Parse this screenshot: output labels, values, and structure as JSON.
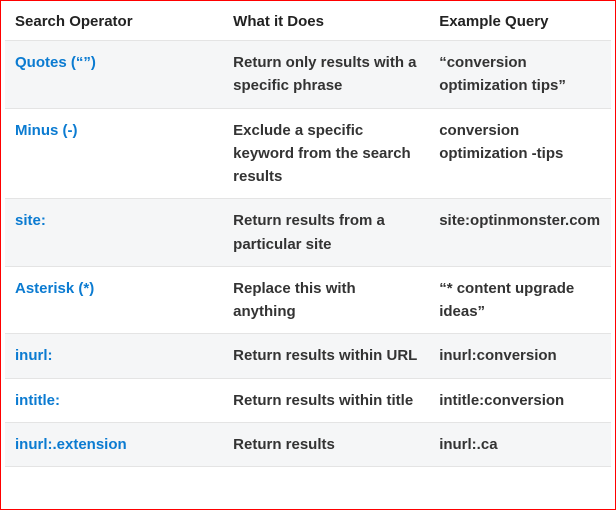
{
  "headers": {
    "operator": "Search Operator",
    "does": "What it Does",
    "example": "Example Query"
  },
  "rows": [
    {
      "operator": "Quotes (“”)",
      "does": "Return only results with a specific phrase",
      "example": "“conversion optimization tips”"
    },
    {
      "operator": "Minus (-)",
      "does": "Exclude a specific keyword from the search results",
      "example": "conversion optimization -tips"
    },
    {
      "operator": "site:",
      "does": "Return results from a particular site",
      "example": "site:optinmonster.com"
    },
    {
      "operator": "Asterisk (*)",
      "does": "Replace this with anything",
      "example": "“* content upgrade ideas”"
    },
    {
      "operator": "inurl:",
      "does": "Return results within URL",
      "example": "inurl:conversion"
    },
    {
      "operator": "intitle:",
      "does": "Return results within title",
      "example": "intitle:conversion"
    },
    {
      "operator": "inurl:.extension",
      "does": "Return results",
      "example": "inurl:.ca"
    }
  ]
}
